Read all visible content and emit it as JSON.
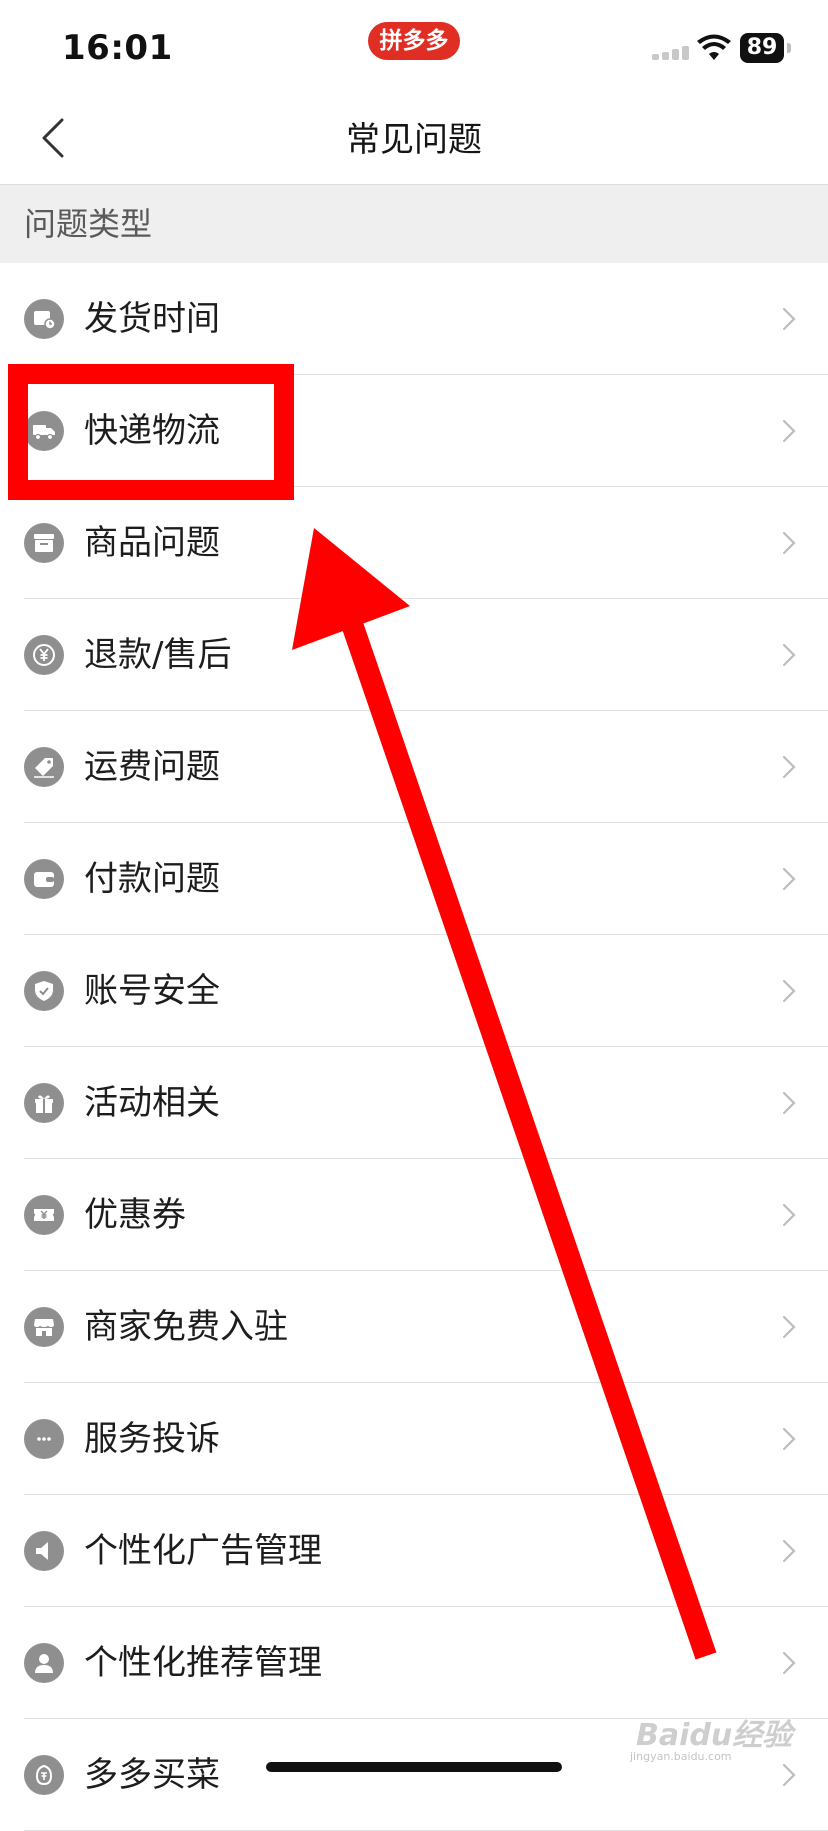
{
  "status_bar": {
    "time": "16:01",
    "app_badge": "拼多多",
    "battery": "89"
  },
  "nav": {
    "title": "常见问题"
  },
  "section": {
    "header": "问题类型"
  },
  "faq_items": [
    {
      "label": "发货时间",
      "icon": "calendar-clock-icon"
    },
    {
      "label": "快递物流",
      "icon": "truck-icon"
    },
    {
      "label": "商品问题",
      "icon": "box-icon"
    },
    {
      "label": "退款/售后",
      "icon": "yen-refund-icon"
    },
    {
      "label": "运费问题",
      "icon": "tag-icon"
    },
    {
      "label": "付款问题",
      "icon": "wallet-icon"
    },
    {
      "label": "账号安全",
      "icon": "shield-check-icon"
    },
    {
      "label": "活动相关",
      "icon": "gift-icon"
    },
    {
      "label": "优惠券",
      "icon": "coupon-icon"
    },
    {
      "label": "商家免费入驻",
      "icon": "store-icon"
    },
    {
      "label": "服务投诉",
      "icon": "chat-bubble-icon"
    },
    {
      "label": "个性化广告管理",
      "icon": "speaker-icon"
    },
    {
      "label": "个性化推荐管理",
      "icon": "user-icon"
    },
    {
      "label": "多多买菜",
      "icon": "vegetable-icon"
    }
  ],
  "watermark": {
    "brand": "Baidu经验",
    "sub": "jingyan.baidu.com"
  },
  "colors": {
    "accent_red": "#e02e24",
    "annotation_red": "#ff0000",
    "icon_gray": "#8f8f8f"
  }
}
